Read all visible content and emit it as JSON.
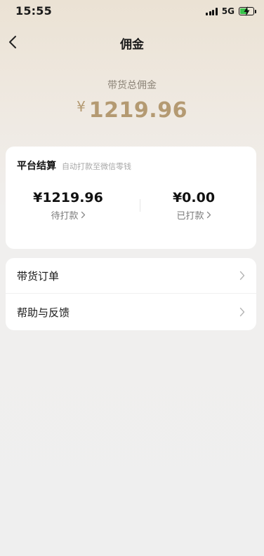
{
  "status_bar": {
    "time": "15:55",
    "network": "5G"
  },
  "nav": {
    "title": "佣金"
  },
  "summary": {
    "label": "带货总佣金",
    "currency": "¥",
    "amount": "1219.96"
  },
  "settlement": {
    "title": "平台结算",
    "subtitle": "自动打款至微信零钱",
    "pending": {
      "value": "¥1219.96",
      "label": "待打款"
    },
    "paid": {
      "value": "¥0.00",
      "label": "已打款"
    }
  },
  "menu": [
    {
      "label": "带货订单"
    },
    {
      "label": "帮助与反馈"
    }
  ],
  "colors": {
    "accent": "#b49a72",
    "battery": "#37c24a"
  }
}
